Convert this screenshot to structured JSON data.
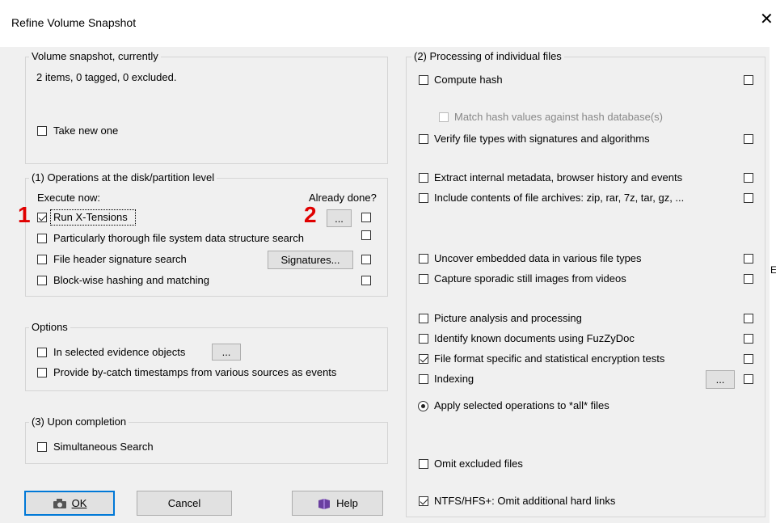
{
  "window": {
    "title": "Refine Volume Snapshot",
    "close_symbol": "✕",
    "edge_char": "E"
  },
  "snapshot": {
    "legend": "Volume snapshot, currently",
    "status": "2 items, 0 tagged, 0 excluded.",
    "take_new": {
      "label": "Take new one",
      "checked": false
    }
  },
  "ops": {
    "legend": "(1) Operations at the disk/partition level",
    "execute_now": "Execute now:",
    "already_done": "Already done?",
    "items": [
      {
        "label": "Run X-Tensions",
        "checked": true,
        "done": false
      },
      {
        "label": "Particularly thorough file system data structure search",
        "checked": false,
        "done": false
      },
      {
        "label": "File header signature search",
        "checked": false,
        "done": false
      },
      {
        "label": "Block-wise hashing and matching",
        "checked": false,
        "done": false
      }
    ],
    "xtensions_more": "...",
    "signatures_button": "Signatures..."
  },
  "options": {
    "legend": "Options",
    "items": [
      {
        "label": "In selected evidence objects",
        "checked": false
      },
      {
        "label": "Provide by-catch timestamps from various sources as events",
        "checked": false
      }
    ],
    "more": "..."
  },
  "completion": {
    "legend": "(3) Upon completion",
    "simultaneous": {
      "label": "Simultaneous Search",
      "checked": false
    }
  },
  "buttons": {
    "ok": "OK",
    "cancel": "Cancel",
    "help": "Help"
  },
  "annotations": {
    "one": "1",
    "two": "2"
  },
  "processing": {
    "legend": "(2) Processing of individual files",
    "items": [
      {
        "label": "Compute hash",
        "checked": false,
        "done": false
      },
      {
        "label": "Match hash values against hash database(s)",
        "checked": false,
        "disabled": true
      },
      {
        "label": "Verify file types with signatures and algorithms",
        "checked": false,
        "done": false
      },
      {
        "label": "Extract internal metadata, browser history and events",
        "checked": false,
        "done": false
      },
      {
        "label": "Include contents of file archives: zip, rar, 7z, tar, gz, ...",
        "checked": false,
        "done": false
      },
      {
        "label": "Uncover embedded data in various file types",
        "checked": false,
        "done": false
      },
      {
        "label": "Capture sporadic still images from videos",
        "checked": false,
        "done": false
      },
      {
        "label": "Picture analysis and processing",
        "checked": false,
        "done": false
      },
      {
        "label": "Identify known documents using FuzZyDoc",
        "checked": false,
        "done": false
      },
      {
        "label": "File format specific and statistical encryption tests",
        "checked": true,
        "done": false
      },
      {
        "label": "Indexing",
        "checked": false,
        "done": false
      }
    ],
    "indexing_more": "...",
    "apply_all": {
      "label": "Apply selected operations to *all* files",
      "selected": true
    },
    "omit_excluded": {
      "label": "Omit excluded files",
      "checked": false
    },
    "omit_hardlinks": {
      "label": "NTFS/HFS+: Omit additional hard links",
      "checked": true
    }
  },
  "icons": {
    "ok": "camera-icon",
    "help": "help-book-icon",
    "close": "close-icon"
  },
  "colors": {
    "annotation": "#e00000",
    "focus": "#0078d7"
  }
}
